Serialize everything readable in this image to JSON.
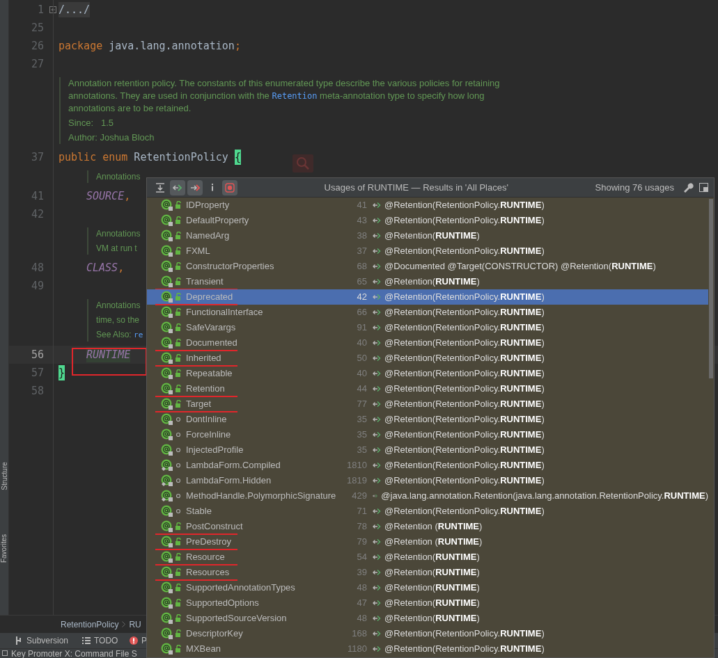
{
  "side_strip": {
    "labels": [
      "Structure",
      "Favorites"
    ]
  },
  "editor": {
    "lines": [
      {
        "kind": "code",
        "number": "1",
        "current": false,
        "indent": false,
        "tokens": [
          {
            "text": "/.../",
            "kind": "folded"
          }
        ]
      },
      {
        "kind": "code",
        "number": "25",
        "current": false
      },
      {
        "kind": "code",
        "number": "26",
        "current": false,
        "indent": false,
        "tokens": [
          {
            "text": "package",
            "kind": "keyword"
          },
          {
            "text": " java.lang.annotation",
            "kind": "plain"
          },
          {
            "text": ";",
            "kind": "punct"
          }
        ]
      },
      {
        "kind": "code",
        "number": "27",
        "current": false
      },
      {
        "kind": "doc",
        "indent": false,
        "paragraphs": [
          [
            {
              "text": "Annotation retention policy. The constants of this enumerated type describe the various policies for retaining annotations. They are used in conjunction with the ",
              "kind": "text"
            },
            {
              "text": "Retention",
              "kind": "code"
            },
            {
              "text": " meta-annotation type to specify how long annotations are to be retained.",
              "kind": "text"
            }
          ],
          [
            {
              "text": "Since:   1.5",
              "kind": "text"
            }
          ],
          [
            {
              "text": "Author: Joshua Bloch",
              "kind": "text"
            }
          ]
        ]
      },
      {
        "kind": "code",
        "number": "37",
        "current": false,
        "indent": false,
        "tokens": [
          {
            "text": "public enum",
            "kind": "keyword"
          },
          {
            "text": " RetentionPolicy ",
            "kind": "plain"
          },
          {
            "text": "{",
            "kind": "brace"
          }
        ]
      },
      {
        "kind": "doc",
        "indent": true,
        "paragraphs": [
          [
            {
              "text": "Annotations",
              "kind": "text"
            }
          ]
        ]
      },
      {
        "kind": "code",
        "number": "41",
        "current": false,
        "indent": true,
        "tokens": [
          {
            "text": "SOURCE",
            "kind": "constant"
          },
          {
            "text": ",",
            "kind": "punct"
          }
        ]
      },
      {
        "kind": "code",
        "number": "42",
        "current": false
      },
      {
        "kind": "doc",
        "indent": true,
        "paragraphs": [
          [
            {
              "text": "Annotations",
              "kind": "text"
            }
          ],
          [
            {
              "text": "VM at run t",
              "kind": "text"
            }
          ]
        ]
      },
      {
        "kind": "code",
        "number": "48",
        "current": false,
        "indent": true,
        "tokens": [
          {
            "text": "CLASS",
            "kind": "constant"
          },
          {
            "text": ",",
            "kind": "punct"
          }
        ]
      },
      {
        "kind": "code",
        "number": "49",
        "current": false
      },
      {
        "kind": "doc",
        "indent": true,
        "paragraphs": [
          [
            {
              "text": "Annotations",
              "kind": "text"
            }
          ],
          [
            {
              "text": "time, so the",
              "kind": "text"
            }
          ],
          [
            {
              "text": "See Also: ",
              "kind": "text"
            },
            {
              "text": "re",
              "kind": "code"
            }
          ]
        ]
      },
      {
        "kind": "code",
        "number": "56",
        "current": true,
        "indent": true,
        "tokens": [
          {
            "text": "RUNTIME",
            "kind": "constant-marked"
          }
        ]
      },
      {
        "kind": "code",
        "number": "57",
        "current": false,
        "indent": false,
        "tokens": [
          {
            "text": "}",
            "kind": "brace"
          }
        ]
      },
      {
        "kind": "code",
        "number": "58",
        "current": false
      }
    ]
  },
  "breadcrumbs": [
    "RetentionPolicy",
    "RU"
  ],
  "tool_tabs": [
    "Subversion",
    "TODO",
    "P"
  ],
  "status_bar": "Key Promoter X: Command File S",
  "usages_popup": {
    "toolbar": [
      {
        "on": false
      },
      {
        "on": true
      },
      {
        "on": true
      },
      {
        "on": false
      },
      {
        "on": true
      }
    ],
    "title": "Usages of RUNTIME — Results in 'All Places'",
    "count": "Showing 76 usages",
    "rows": [
      {
        "name": "IDProperty",
        "line": "41",
        "code": "@Retention(RetentionPolicy.**RUNTIME**)",
        "kind": "public",
        "nested": false,
        "selected": false,
        "marked": false
      },
      {
        "name": "DefaultProperty",
        "line": "43",
        "code": "@Retention(RetentionPolicy.**RUNTIME**)",
        "kind": "public",
        "nested": false,
        "selected": false,
        "marked": false
      },
      {
        "name": "NamedArg",
        "line": "38",
        "code": "@Retention(**RUNTIME**)",
        "kind": "public",
        "nested": false,
        "selected": false,
        "marked": false
      },
      {
        "name": "FXML",
        "line": "37",
        "code": "@Retention(RetentionPolicy.**RUNTIME**)",
        "kind": "public",
        "nested": false,
        "selected": false,
        "marked": false
      },
      {
        "name": "ConstructorProperties",
        "line": "68",
        "code": "@Documented @Target(CONSTRUCTOR) @Retention(**RUNTIME**)",
        "kind": "public",
        "nested": false,
        "selected": false,
        "marked": false
      },
      {
        "name": "Transient",
        "line": "65",
        "code": "@Retention(**RUNTIME**)",
        "kind": "public",
        "nested": false,
        "selected": false,
        "marked": true
      },
      {
        "name": "Deprecated",
        "line": "42",
        "code": "@Retention(RetentionPolicy.**RUNTIME**)",
        "kind": "public",
        "nested": false,
        "selected": true,
        "marked": true
      },
      {
        "name": "FunctionalInterface",
        "line": "66",
        "code": "@Retention(RetentionPolicy.**RUNTIME**)",
        "kind": "public",
        "nested": false,
        "selected": false,
        "marked": false
      },
      {
        "name": "SafeVarargs",
        "line": "91",
        "code": "@Retention(RetentionPolicy.**RUNTIME**)",
        "kind": "public",
        "nested": false,
        "selected": false,
        "marked": false
      },
      {
        "name": "Documented",
        "line": "40",
        "code": "@Retention(RetentionPolicy.**RUNTIME**)",
        "kind": "public",
        "nested": false,
        "selected": false,
        "marked": true
      },
      {
        "name": "Inherited",
        "line": "50",
        "code": "@Retention(RetentionPolicy.**RUNTIME**)",
        "kind": "public",
        "nested": false,
        "selected": false,
        "marked": true
      },
      {
        "name": "Repeatable",
        "line": "40",
        "code": "@Retention(RetentionPolicy.**RUNTIME**)",
        "kind": "public",
        "nested": false,
        "selected": false,
        "marked": false
      },
      {
        "name": "Retention",
        "line": "44",
        "code": "@Retention(RetentionPolicy.**RUNTIME**)",
        "kind": "public",
        "nested": false,
        "selected": false,
        "marked": true
      },
      {
        "name": "Target",
        "line": "77",
        "code": "@Retention(RetentionPolicy.**RUNTIME**)",
        "kind": "public",
        "nested": false,
        "selected": false,
        "marked": true
      },
      {
        "name": "DontInline",
        "line": "35",
        "code": "@Retention(RetentionPolicy.**RUNTIME**)",
        "kind": "package",
        "nested": false,
        "selected": false,
        "marked": false
      },
      {
        "name": "ForceInline",
        "line": "35",
        "code": "@Retention(RetentionPolicy.**RUNTIME**)",
        "kind": "package",
        "nested": false,
        "selected": false,
        "marked": false
      },
      {
        "name": "InjectedProfile",
        "line": "35",
        "code": "@Retention(RetentionPolicy.**RUNTIME**)",
        "kind": "package",
        "nested": false,
        "selected": false,
        "marked": false
      },
      {
        "name": "LambdaForm.Compiled",
        "line": "1810",
        "code": "@Retention(RetentionPolicy.**RUNTIME**)",
        "kind": "package",
        "nested": true,
        "selected": false,
        "marked": false
      },
      {
        "name": "LambdaForm.Hidden",
        "line": "1819",
        "code": "@Retention(RetentionPolicy.**RUNTIME**)",
        "kind": "package",
        "nested": true,
        "selected": false,
        "marked": false
      },
      {
        "name": "MethodHandle.PolymorphicSignature",
        "line": "429",
        "code": "@java.lang.annotation.Retention(java.lang.annotation.RetentionPolicy.**RUNTIME**)",
        "kind": "package",
        "nested": true,
        "selected": false,
        "marked": false
      },
      {
        "name": "Stable",
        "line": "71",
        "code": "@Retention(RetentionPolicy.**RUNTIME**)",
        "kind": "package",
        "nested": false,
        "selected": false,
        "marked": false
      },
      {
        "name": "PostConstruct",
        "line": "78",
        "code": "@Retention (**RUNTIME**)",
        "kind": "public",
        "nested": false,
        "selected": false,
        "marked": true
      },
      {
        "name": "PreDestroy",
        "line": "79",
        "code": "@Retention (**RUNTIME**)",
        "kind": "public",
        "nested": false,
        "selected": false,
        "marked": true
      },
      {
        "name": "Resource",
        "line": "54",
        "code": "@Retention(**RUNTIME**)",
        "kind": "public",
        "nested": false,
        "selected": false,
        "marked": true
      },
      {
        "name": "Resources",
        "line": "39",
        "code": "@Retention(**RUNTIME**)",
        "kind": "public",
        "nested": false,
        "selected": false,
        "marked": true
      },
      {
        "name": "SupportedAnnotationTypes",
        "line": "48",
        "code": "@Retention(**RUNTIME**)",
        "kind": "public",
        "nested": false,
        "selected": false,
        "marked": false
      },
      {
        "name": "SupportedOptions",
        "line": "47",
        "code": "@Retention(**RUNTIME**)",
        "kind": "public",
        "nested": false,
        "selected": false,
        "marked": false
      },
      {
        "name": "SupportedSourceVersion",
        "line": "48",
        "code": "@Retention(**RUNTIME**)",
        "kind": "public",
        "nested": false,
        "selected": false,
        "marked": false
      },
      {
        "name": "DescriptorKey",
        "line": "168",
        "code": "@Retention(RetentionPolicy.**RUNTIME**)",
        "kind": "public",
        "nested": false,
        "selected": false,
        "marked": false
      },
      {
        "name": "MXBean",
        "line": "1180",
        "code": "@Retention(RetentionPolicy.**RUNTIME**)",
        "kind": "public",
        "nested": false,
        "selected": false,
        "marked": false
      }
    ]
  }
}
